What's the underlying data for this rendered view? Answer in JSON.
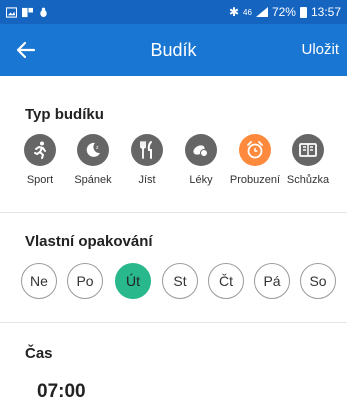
{
  "status_bar": {
    "battery": "72%",
    "signal": "46",
    "time": "13:57"
  },
  "app_bar": {
    "title": "Budík",
    "save_label": "Uložit"
  },
  "type_section": {
    "title": "Typ budíku",
    "items": [
      {
        "label": "Sport",
        "icon": "run-icon",
        "active": false
      },
      {
        "label": "Spánek",
        "icon": "moon-icon",
        "active": false
      },
      {
        "label": "Jíst",
        "icon": "cutlery-icon",
        "active": false
      },
      {
        "label": "Léky",
        "icon": "pills-icon",
        "active": false
      },
      {
        "label": "Probuzení",
        "icon": "alarm-clock-icon",
        "active": true
      },
      {
        "label": "Schůzka",
        "icon": "book-icon",
        "active": false
      }
    ]
  },
  "repeat_section": {
    "title": "Vlastní opakování",
    "days": [
      {
        "label": "Ne",
        "active": false
      },
      {
        "label": "Po",
        "active": false
      },
      {
        "label": "Út",
        "active": true
      },
      {
        "label": "St",
        "active": false
      },
      {
        "label": "Čt",
        "active": false
      },
      {
        "label": "Pá",
        "active": false
      },
      {
        "label": "So",
        "active": false
      }
    ]
  },
  "time_section": {
    "title": "Čas",
    "value": "07:00"
  },
  "colors": {
    "header": "#1976d2",
    "status_bar": "#1565c0",
    "active_type": "#ff8a3d",
    "active_day": "#28b88c"
  }
}
